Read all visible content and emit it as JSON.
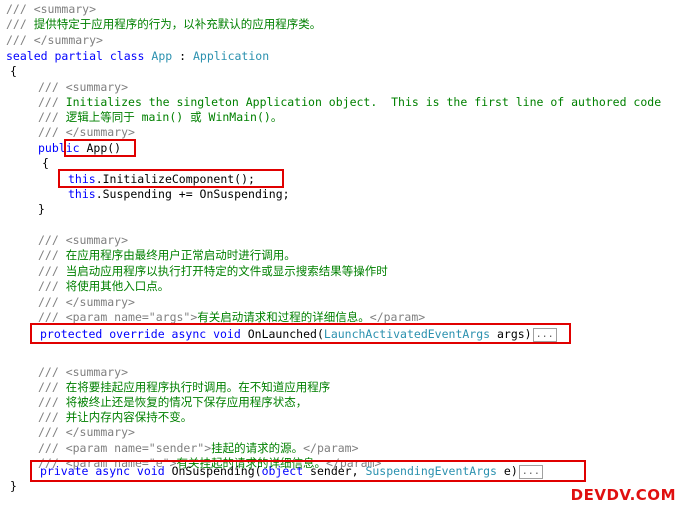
{
  "code": {
    "l1": {
      "slash": "/// ",
      "tag": "<summary>"
    },
    "l2": {
      "slash": "/// ",
      "text": "提供特定于应用程序的行为，以补充默认的应用程序类。"
    },
    "l3": {
      "slash": "/// ",
      "tag": "</summary>"
    },
    "l4": {
      "kw": "sealed partial class ",
      "type": "App",
      "sep": " : ",
      "base": "Application"
    },
    "l5": {
      "text": "{"
    },
    "l6": {
      "slash": "/// ",
      "tag": "<summary>"
    },
    "l7": {
      "slash": "/// ",
      "text": "Initializes the singleton Application object.  This is the first line of authored code"
    },
    "l8": {
      "slash": "/// ",
      "text": "逻辑上等同于 main() 或 WinMain()。"
    },
    "l9": {
      "slash": "/// ",
      "tag": "</summary>"
    },
    "l10": {
      "kw": "public",
      "text": " App()"
    },
    "l11": {
      "text": "{"
    },
    "l12": {
      "kw": "this",
      "text": ".InitializeComponent();"
    },
    "l13": {
      "kw": "this",
      "text": ".Suspending += OnSuspending;"
    },
    "l14": {
      "text": "}"
    },
    "l15": {
      "slash": "/// ",
      "tag": "<summary>"
    },
    "l16": {
      "slash": "/// ",
      "text": "在应用程序由最终用户正常启动时进行调用。"
    },
    "l17": {
      "slash": "/// ",
      "text": "当启动应用程序以执行打开特定的文件或显示搜索结果等操作时"
    },
    "l18": {
      "slash": "/// ",
      "text": "将使用其他入口点。"
    },
    "l19": {
      "slash": "/// ",
      "tag": "</summary>"
    },
    "l20": {
      "slash": "/// ",
      "tagopen": "<param name=\"",
      "attr": "args",
      "tagmid": "\">",
      "text": "有关启动请求和过程的详细信息。",
      "tagclose": "</param>"
    },
    "l21": {
      "kw": "protected override async void ",
      "name": "OnLaunched(",
      "type": "LaunchActivatedEventArgs",
      "rest": " args)",
      "fold": "..."
    },
    "l22": {
      "slash": "/// ",
      "tag": "<summary>"
    },
    "l23": {
      "slash": "/// ",
      "text": "在将要挂起应用程序执行时调用。在不知道应用程序"
    },
    "l24": {
      "slash": "/// ",
      "text": "将被终止还是恢复的情况下保存应用程序状态，"
    },
    "l25": {
      "slash": "/// ",
      "text": "并让内存内容保持不变。"
    },
    "l26": {
      "slash": "/// ",
      "tag": "</summary>"
    },
    "l27": {
      "slash": "/// ",
      "tagopen": "<param name=\"",
      "attr": "sender",
      "tagmid": "\">",
      "text": "挂起的请求的源。",
      "tagclose": "</param>"
    },
    "l28": {
      "slash": "/// ",
      "tagopen": "<param name=\"",
      "attr": "e",
      "tagmid": "\">",
      "text": "有关挂起的请求的详细信息。",
      "tagclose": "</param>"
    },
    "l29": {
      "kw": "private async void ",
      "name": "OnSuspending(",
      "kw2": "object",
      "mid": " sender, ",
      "type": "SuspendingEventArgs",
      "rest": " e)",
      "fold": "..."
    },
    "l30": {
      "text": "}"
    }
  },
  "watermark": "DEVDV.COM",
  "colors": {
    "comment": "#008000",
    "doc_tag": "#808080",
    "keyword": "#0000ff",
    "type": "#2b91af",
    "highlight": "#e00000"
  }
}
